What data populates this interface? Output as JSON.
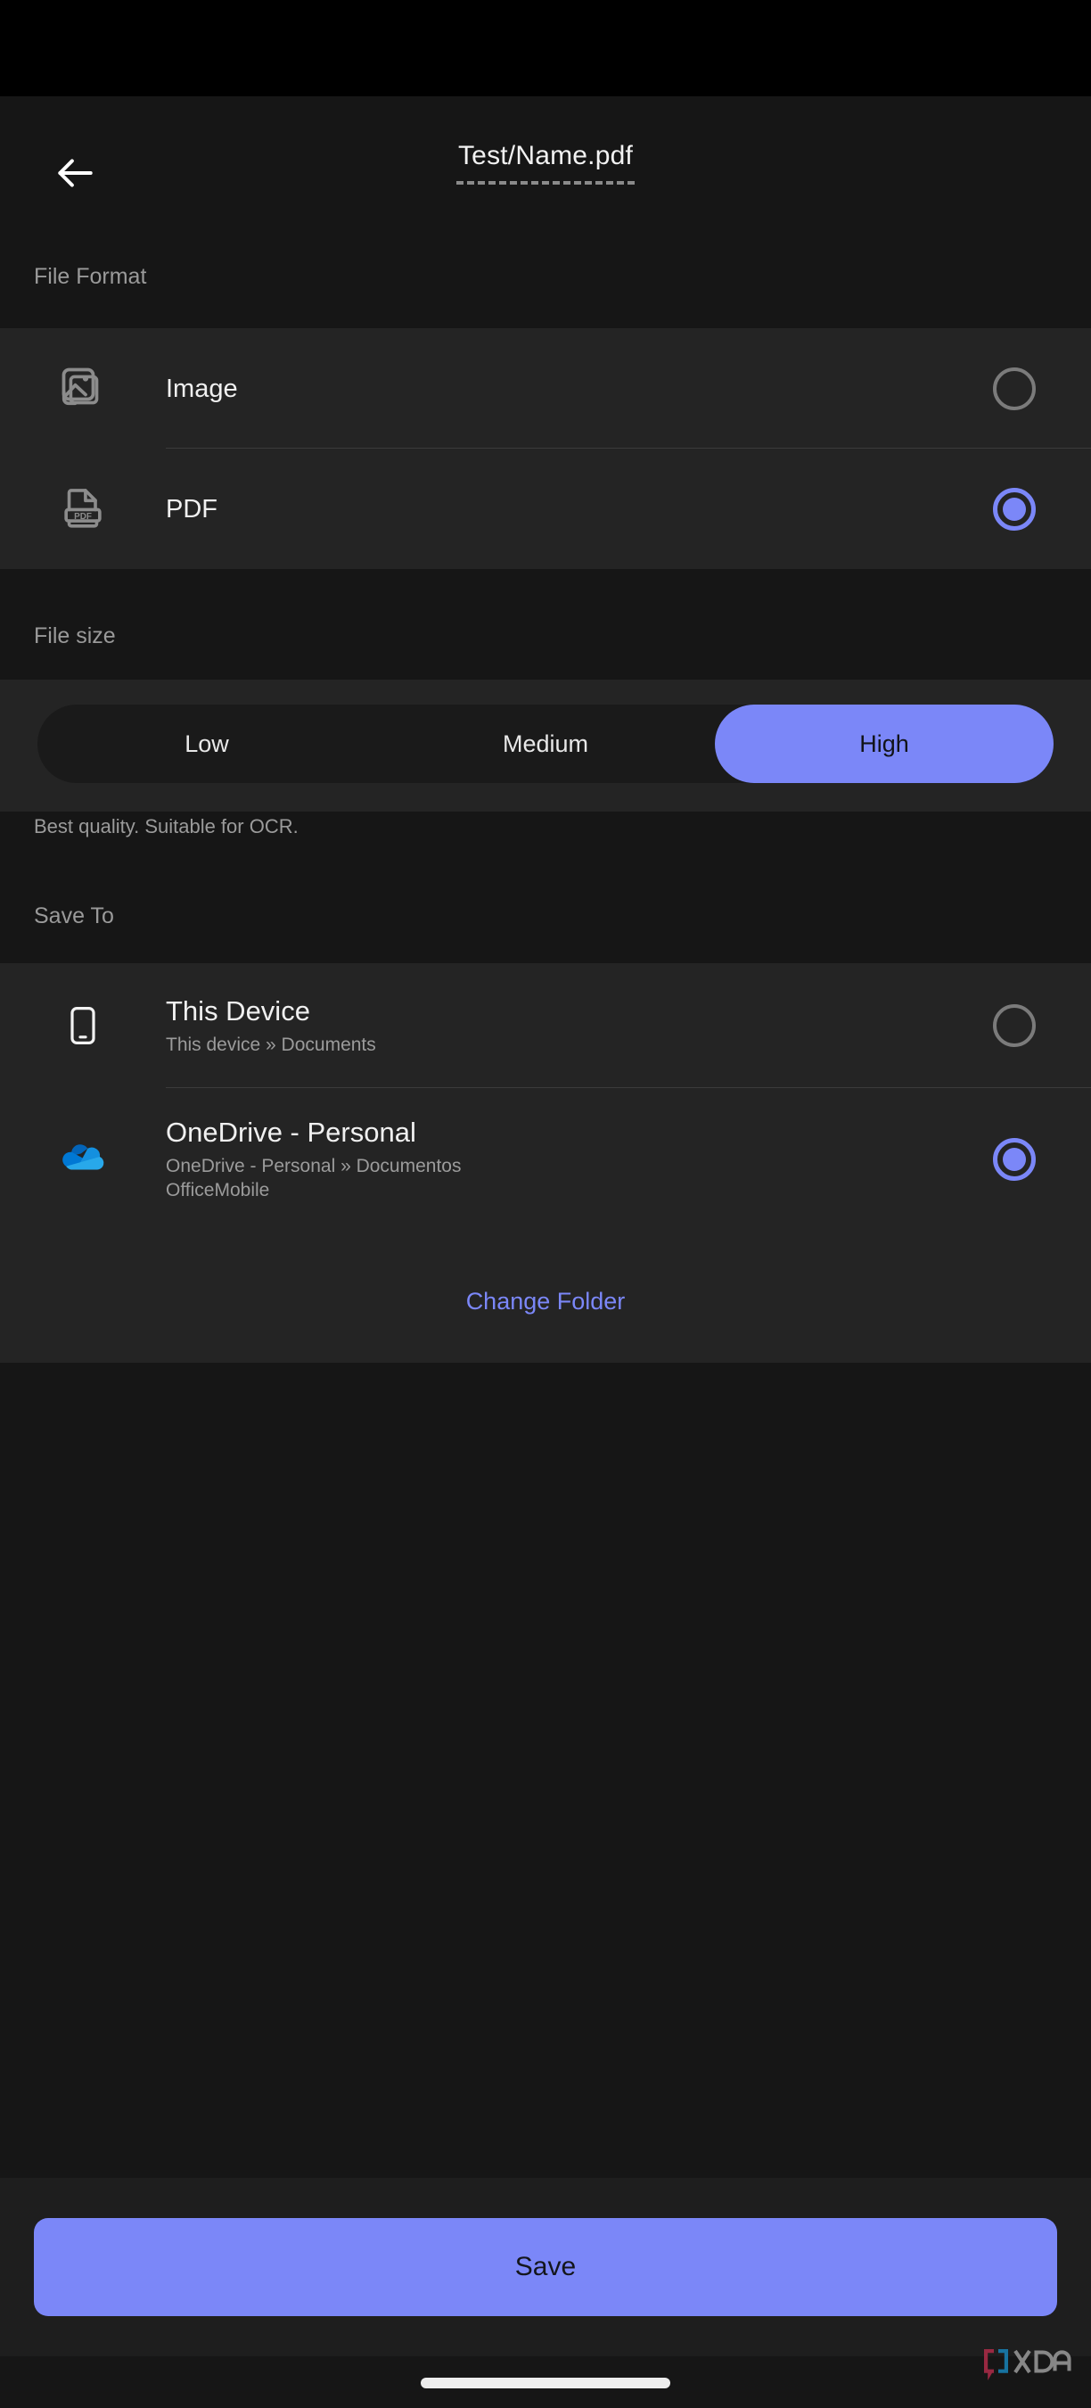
{
  "appbar": {
    "back_icon": "arrow-left-icon",
    "title": "Test/Name.pdf"
  },
  "sections": {
    "file_format_label": "File Format",
    "file_size_label": "File size",
    "save_to_label": "Save To"
  },
  "file_format": {
    "options": [
      {
        "icon": "image-icon",
        "label": "Image",
        "selected": false
      },
      {
        "icon": "pdf-icon",
        "label": "PDF",
        "selected": true
      }
    ]
  },
  "file_size": {
    "options": [
      "Low",
      "Medium",
      "High"
    ],
    "selected": "High",
    "hint": "Best quality. Suitable for OCR."
  },
  "save_to": {
    "options": [
      {
        "icon": "phone-icon",
        "title": "This Device",
        "subtitle": "This device » Documents",
        "subtitle2": "",
        "selected": false
      },
      {
        "icon": "onedrive-icon",
        "title": "OneDrive - Personal",
        "subtitle": "OneDrive - Personal » Documentos",
        "subtitle2": "OfficeMobile",
        "selected": true
      }
    ],
    "change_folder_label": "Change Folder"
  },
  "footer": {
    "save_label": "Save"
  },
  "watermark": {
    "text": "XDA"
  },
  "colors": {
    "accent": "#7b87f8",
    "page_bg": "#161616",
    "card_bg": "#242424",
    "status_bar": "#000000",
    "muted_text": "#9b9b9b",
    "primary_text": "#f0f0f0"
  }
}
